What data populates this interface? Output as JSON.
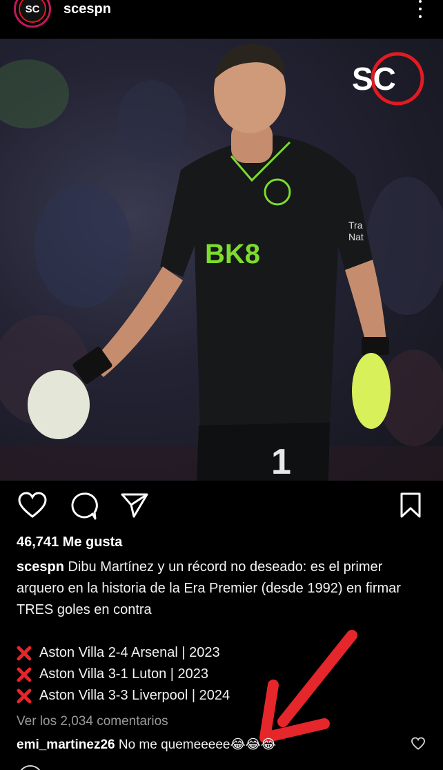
{
  "header": {
    "avatar_text": "SC",
    "username": "scespn",
    "more_icon": "more-vertical-icon"
  },
  "photo": {
    "logo_text": "SC",
    "jersey_sponsor": "BK8",
    "sleeve_text_1": "Tra",
    "sleeve_text_2": "Nat",
    "shirt_number": "1"
  },
  "actions": {
    "like_icon": "heart-icon",
    "comment_icon": "comment-icon",
    "share_icon": "send-icon",
    "save_icon": "bookmark-icon"
  },
  "post": {
    "likes": "46,741 Me gusta",
    "caption_user": "scespn",
    "caption_text": "Dibu Martínez y un récord no deseado: es el primer arquero en la historia de la Era Premier (desde 1992) en firmar TRES goles en contra",
    "list": [
      "Aston Villa 2-4 Arsenal | 2023",
      "Aston Villa 3-1 Luton | 2023",
      "Aston Villa 3-3 Liverpool | 2024"
    ],
    "view_comments": "Ver los 2,034 comentarios"
  },
  "comment": {
    "user": "emi_martinez26",
    "text": "No me quemeeeee",
    "emojis": "😂😂😂"
  },
  "colors": {
    "accent_red": "#e21b23",
    "arrow_red": "#e5262b",
    "jersey_green": "#7ddc2e"
  }
}
